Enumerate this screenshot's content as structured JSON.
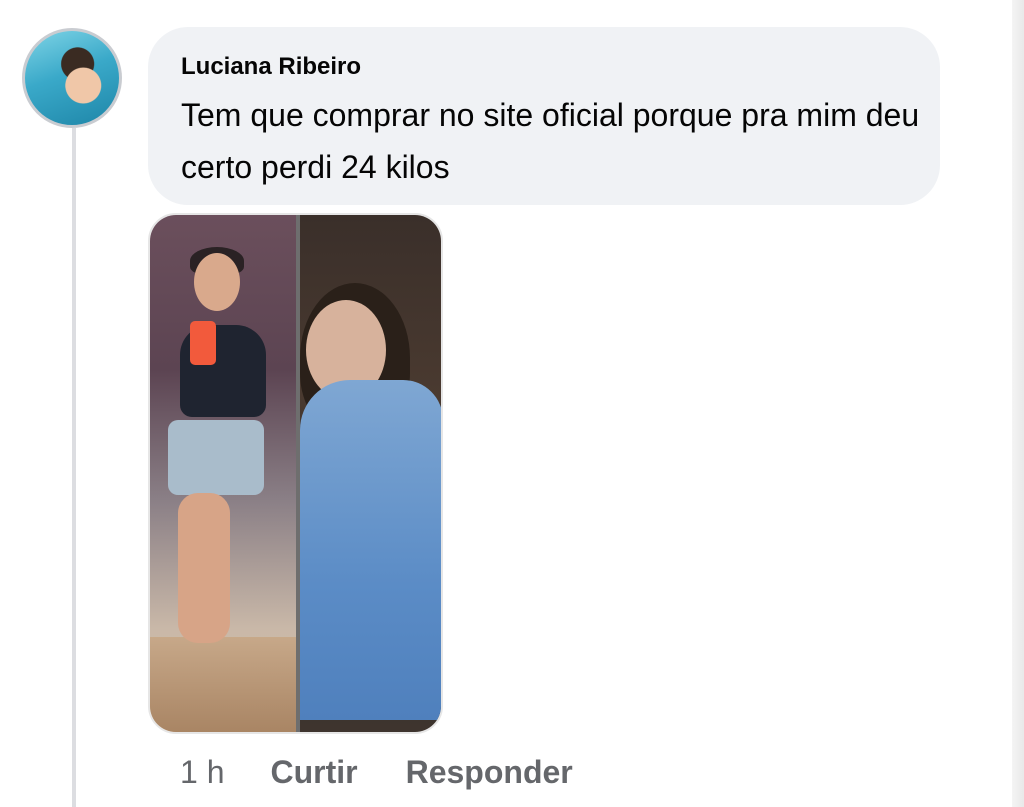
{
  "comment": {
    "author": "Luciana Ribeiro",
    "text": "Tem que comprar no site oficial porque pra mim deu certo perdi 24 kilos",
    "avatar_icon": "profile-photo",
    "attachment_icon": "before-after-photo"
  },
  "actions": {
    "time": "1 h",
    "like_label": "Curtir",
    "reply_label": "Responder"
  },
  "colors": {
    "bubble": "#f0f2f5",
    "text": "#050505",
    "meta": "#65676b"
  }
}
